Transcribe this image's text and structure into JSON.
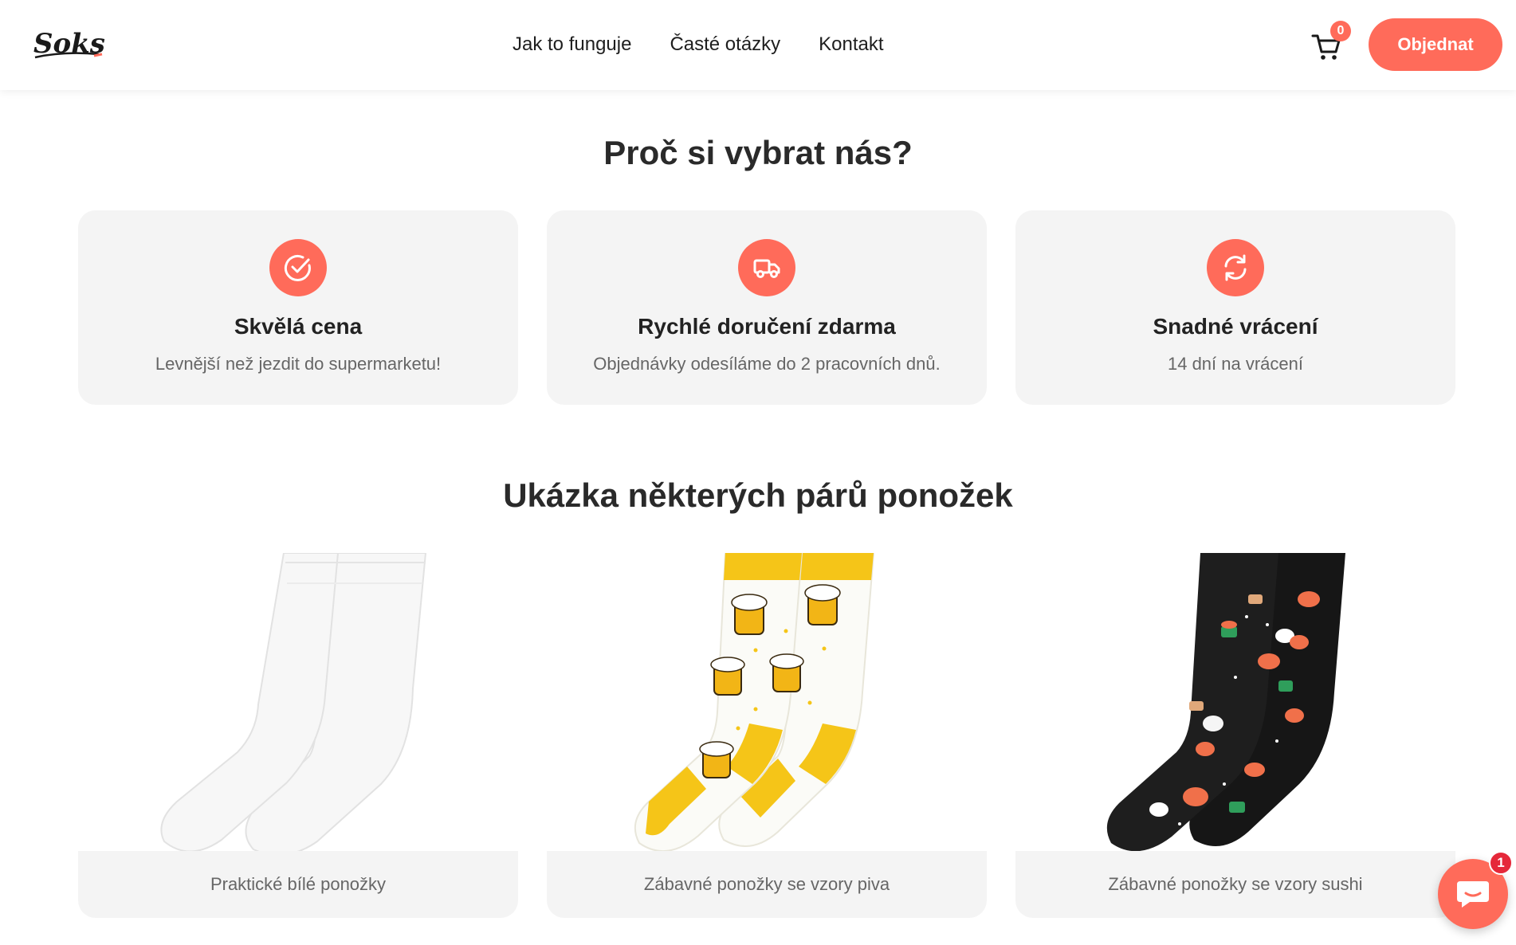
{
  "header": {
    "logo_text": "Soks",
    "nav": [
      "Jak to funguje",
      "Časté otázky",
      "Kontakt"
    ],
    "cart_count": "0",
    "order_label": "Objednat"
  },
  "why": {
    "title": "Proč si vybrat nás?",
    "cards": [
      {
        "icon": "check-circle-icon",
        "title": "Skvělá cena",
        "desc": "Levnější než jezdit do supermarketu!"
      },
      {
        "icon": "truck-icon",
        "title": "Rychlé doručení zdarma",
        "desc": "Objednávky odesíláme do 2 pracovních dnů."
      },
      {
        "icon": "refresh-icon",
        "title": "Snadné vrácení",
        "desc": "14 dní na vrácení"
      }
    ]
  },
  "samples": {
    "title": "Ukázka některých párů ponožek",
    "products": [
      {
        "label": "Praktické bílé ponožky"
      },
      {
        "label": "Zábavné ponožky se vzory piva"
      },
      {
        "label": "Zábavné ponožky se vzory sushi"
      }
    ]
  },
  "chat": {
    "unread": "1"
  },
  "colors": {
    "accent": "#ff6b5a",
    "card_bg": "#f4f4f4",
    "sock_yellow": "#f5c518",
    "sock_black": "#1a1a1a"
  }
}
